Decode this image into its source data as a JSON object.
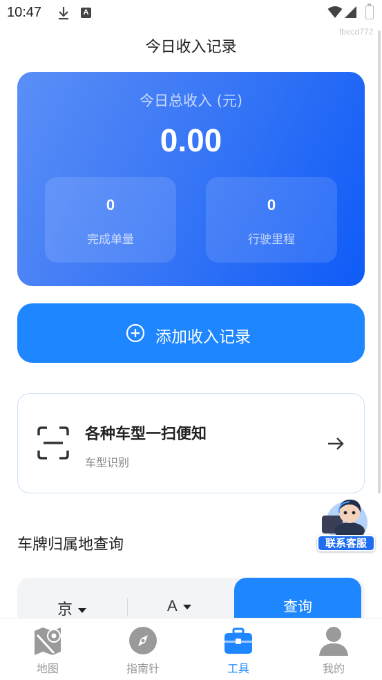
{
  "status_bar": {
    "time": "10:47",
    "a_badge": "A",
    "watermark": "fbecd772"
  },
  "header": {
    "title": "今日收入记录"
  },
  "income_card": {
    "label": "今日总收入 (元)",
    "total": "0.00",
    "stats": [
      {
        "value": "0",
        "label": "完成单量"
      },
      {
        "value": "0",
        "label": "行驶里程"
      }
    ]
  },
  "add_record": {
    "label": "添加收入记录",
    "icon": "plus-circle-icon"
  },
  "scan_card": {
    "title": "各种车型一扫便知",
    "subtitle": "车型识别",
    "icon": "scan-icon",
    "arrow_icon": "arrow-right-icon"
  },
  "plate_query": {
    "section_title": "车牌归属地查询",
    "province": "京",
    "letter": "A",
    "query_label": "查询"
  },
  "service": {
    "label": "联系客服"
  },
  "bottom_nav": {
    "items": [
      {
        "label": "地图",
        "icon": "map-icon",
        "active": false
      },
      {
        "label": "指南针",
        "icon": "compass-icon",
        "active": false
      },
      {
        "label": "工具",
        "icon": "toolbox-icon",
        "active": true
      },
      {
        "label": "我的",
        "icon": "user-icon",
        "active": false
      }
    ]
  },
  "colors": {
    "accent": "#1e86ff",
    "card_gradient_start": "#5b8ff7",
    "card_gradient_end": "#0e5bf7",
    "inactive": "#999999"
  }
}
